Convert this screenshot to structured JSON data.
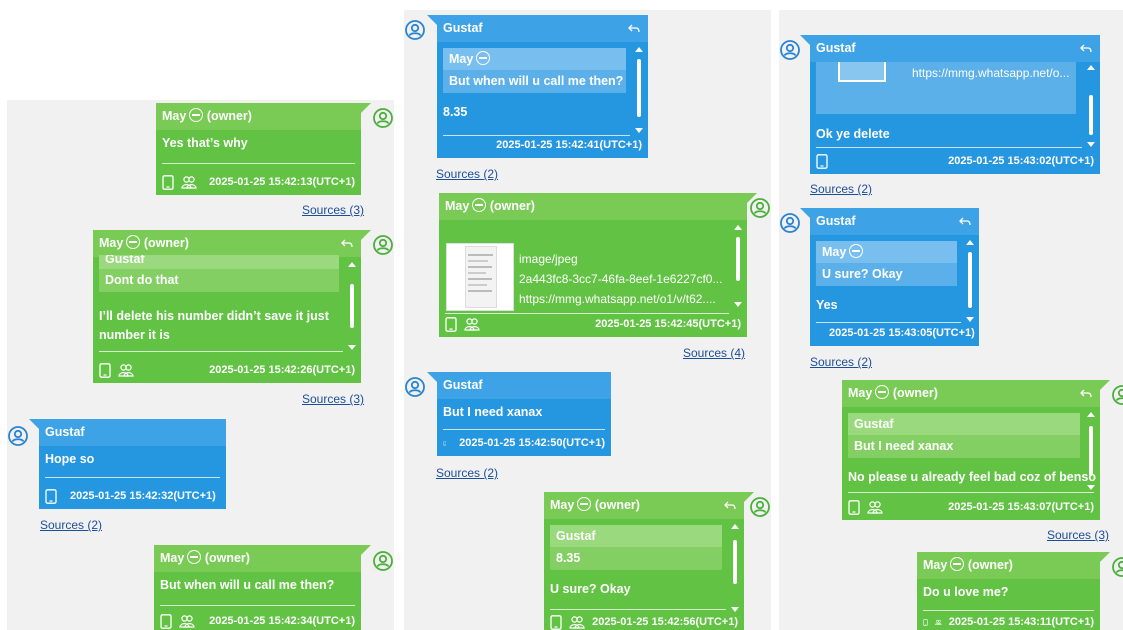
{
  "sources_label_prefix": "Sources",
  "owner_suffix": "(owner)",
  "sender_may": "May",
  "sender_gustaf": "Gustaf",
  "colors": {
    "outgoing": "#62c244",
    "incoming": "#2596e0",
    "link": "#1d4e9a"
  },
  "col1": {
    "m1": {
      "text": "Yes that’s why",
      "ts": "2025-01-25 15:42:13(UTC+1)",
      "sources": "Sources (3)"
    },
    "m2": {
      "quote_name": "Gustaf",
      "quote_text": "Dont do that",
      "text": "I’ll delete his number didn’t save it just number it is",
      "ts": "2025-01-25 15:42:26(UTC+1)",
      "sources": "Sources (3)"
    },
    "m3": {
      "text": "Hope so",
      "ts": "2025-01-25 15:42:32(UTC+1)",
      "sources": "Sources (2)"
    },
    "m4": {
      "text": "But when will u call me then?",
      "ts": "2025-01-25 15:42:34(UTC+1)"
    }
  },
  "col2": {
    "m1": {
      "quote_name": "May",
      "quote_text": "But when will u call me then?",
      "text": "8.35",
      "ts": "2025-01-25 15:42:41(UTC+1)",
      "sources": "Sources (2)"
    },
    "m2": {
      "mime": "image/jpeg",
      "file_id": "2a443fc8-3cc7-46fa-8eef-1e6227cf0...",
      "url": "https://mmg.whatsapp.net/o1/v/t62....",
      "ts": "2025-01-25 15:42:45(UTC+1)",
      "sources": "Sources (4)"
    },
    "m3": {
      "text": "But I need xanax",
      "ts": "2025-01-25 15:42:50(UTC+1)",
      "sources": "Sources (2)"
    },
    "m4": {
      "quote_name": "Gustaf",
      "quote_text": "8.35",
      "text": "U sure? Okay",
      "ts": "2025-01-25 15:42:56(UTC+1)"
    }
  },
  "col3": {
    "m1": {
      "url": "https://mmg.whatsapp.net/o...",
      "text": "Ok ye delete",
      "ts": "2025-01-25 15:43:02(UTC+1)",
      "sources": "Sources (2)"
    },
    "m2": {
      "quote_name": "May",
      "quote_text": "U sure? Okay",
      "text": "Yes",
      "ts": "2025-01-25 15:43:05(UTC+1)",
      "sources": "Sources (2)"
    },
    "m3": {
      "quote_name": "Gustaf",
      "quote_text": "But I need xanax",
      "text": "No please u already feel bad coz of benso",
      "ts": "2025-01-25 15:43:07(UTC+1)",
      "sources": "Sources (3)"
    },
    "m4": {
      "text": "Do u love me?",
      "ts": "2025-01-25 15:43:11(UTC+1)"
    }
  }
}
